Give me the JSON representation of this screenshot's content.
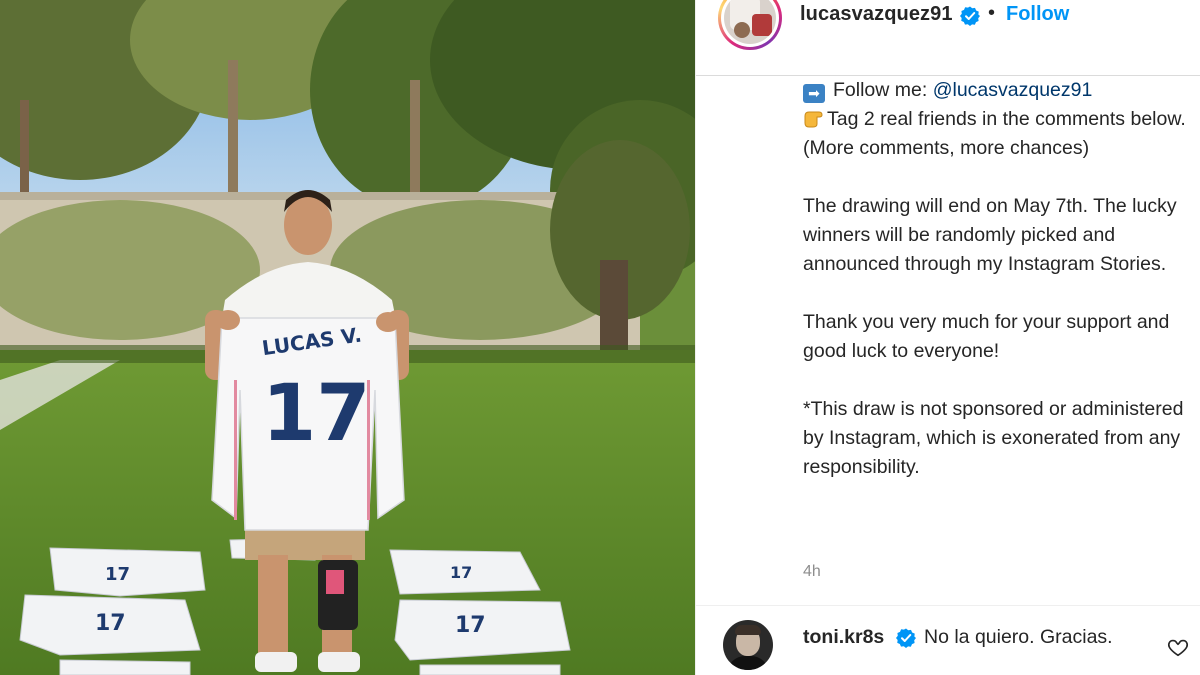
{
  "post": {
    "username": "lucasvazquez91",
    "separator": "•",
    "follow_label": "Follow",
    "caption": {
      "line1_prefix": "Follow me: ",
      "line1_mention": "@lucasvazquez91",
      "para1": "Tag 2 real friends in the comments below. (More comments, more chances)",
      "para2": "The drawing will end on May 7th. The lucky winners will be randomly picked and announced through my Instagram Stories.",
      "para3": "Thank you very much for your support and good luck to everyone!",
      "para4": "*This draw is not sponsored or administered by Instagram, which is exonerated from any responsibility."
    },
    "timestamp": "4h"
  },
  "photo": {
    "jersey_name": "LUCAS V.",
    "jersey_number": "17"
  },
  "comment": {
    "username": "toni.kr8s",
    "text": "No la quiero. Gracias."
  },
  "colors": {
    "accent": "#0095f6",
    "verified": "#0095f6",
    "mention": "#00376b",
    "muted": "#8e8e8e"
  },
  "icons": {
    "verified": "verified-badge-icon",
    "like": "heart-icon",
    "arrow": "right-arrow-emoji",
    "point": "pointing-hand-emoji"
  }
}
